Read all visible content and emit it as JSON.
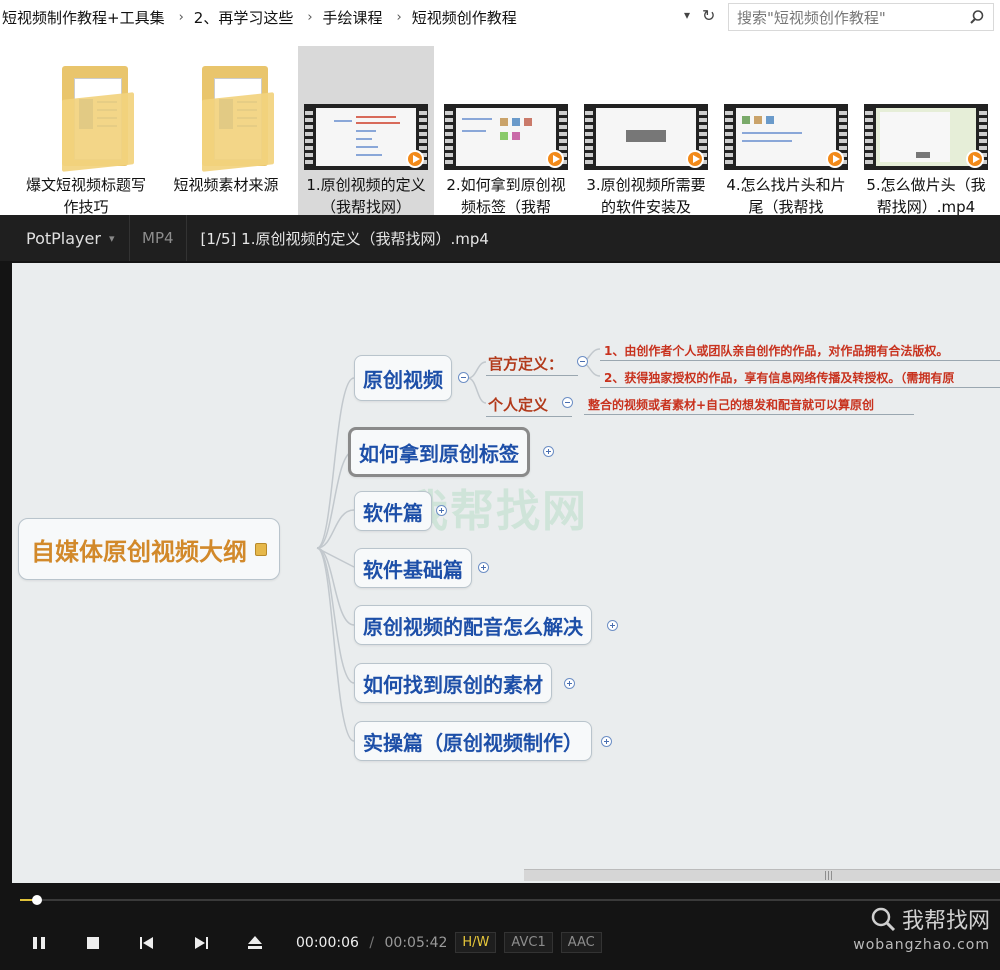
{
  "explorer": {
    "breadcrumbs": [
      "短视频制作教程+工具集",
      "2、再学习这些",
      "手绘课程",
      "短视频创作教程"
    ],
    "search_placeholder": "搜索\"短视频创作教程\"",
    "files": [
      {
        "label": "爆文短视频标题写作技巧",
        "type": "folder"
      },
      {
        "label": "短视频素材来源",
        "type": "folder"
      },
      {
        "label": "1.原创视频的定义（我帮找网）",
        "type": "video",
        "selected": true
      },
      {
        "label": "2.如何拿到原创视频标签（我帮",
        "type": "video"
      },
      {
        "label": "3.原创视频所需要的软件安装及",
        "type": "video"
      },
      {
        "label": "4.怎么找片头和片尾（我帮找",
        "type": "video"
      },
      {
        "label": "5.怎么做片头（我帮找网）.mp4",
        "type": "video"
      }
    ]
  },
  "player": {
    "app_name": "PotPlayer",
    "format": "MP4",
    "title": "[1/5] 1.原创视频的定义（我帮找网）.mp4",
    "current_time": "00:00:06",
    "duration": "00:05:42",
    "progress_fraction": 0.0175,
    "tags": [
      "H/W",
      "AVC1",
      "AAC"
    ],
    "brand_name": "我帮找网",
    "brand_url": "wobangzhao.com"
  },
  "mindmap": {
    "root": "自媒体原创视频大纲",
    "branches": [
      "原创视频",
      "如何拿到原创标签",
      "软件篇",
      "软件基础篇",
      "原创视频的配音怎么解决",
      "如何找到原创的素材",
      "实操篇（原创视频制作）"
    ],
    "official_label": "官方定义：",
    "official_items": [
      "1、由创作者个人或团队亲自创作的作品，对作品拥有合法版权。",
      "2、获得独家授权的作品，享有信息网络传播及转授权。（需拥有原"
    ],
    "personal_label": "个人定义",
    "personal_item": "整合的视频或者素材+自己的想发和配音就可以算原创",
    "watermark": "我帮找网"
  }
}
